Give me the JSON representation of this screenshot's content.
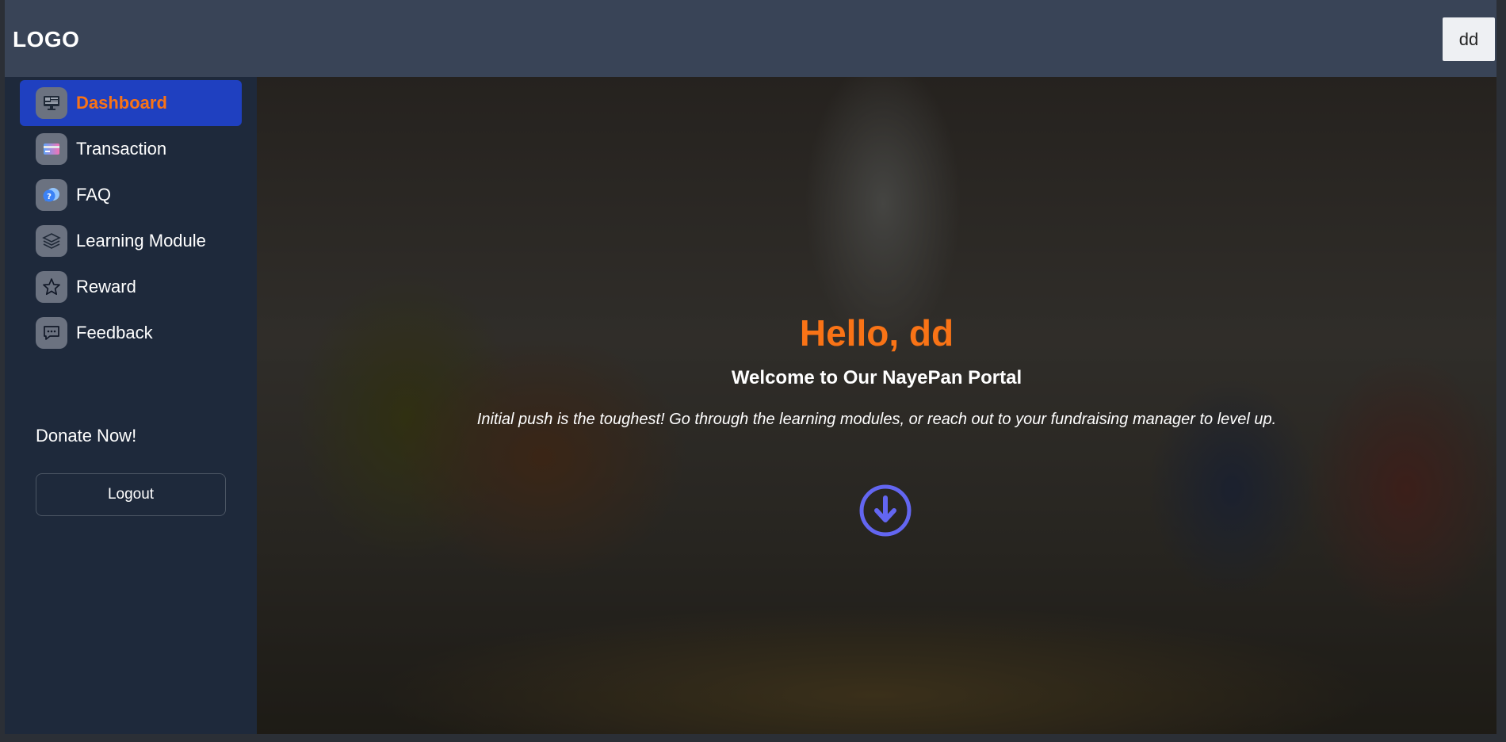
{
  "header": {
    "logo": "LOGO",
    "user_button": "dd"
  },
  "sidebar": {
    "items": [
      {
        "label": "Dashboard",
        "icon": "monitor-icon",
        "active": true
      },
      {
        "label": "Transaction",
        "icon": "credit-card-icon",
        "active": false
      },
      {
        "label": "FAQ",
        "icon": "question-bubble-icon",
        "active": false
      },
      {
        "label": "Learning Module",
        "icon": "layers-icon",
        "active": false
      },
      {
        "label": "Reward",
        "icon": "star-icon",
        "active": false
      },
      {
        "label": "Feedback",
        "icon": "chat-bubble-icon",
        "active": false
      }
    ],
    "donate": "Donate Now!",
    "logout": "Logout"
  },
  "hero": {
    "greeting": "Hello, dd",
    "welcome": "Welcome to Our NayePan Portal",
    "tagline": "Initial push is the toughest! Go through the learning modules, or reach out to your fundraising manager to level up.",
    "scroll_icon": "arrow-down-circle-icon"
  },
  "colors": {
    "accent": "#f97316",
    "active_nav": "#1f40c0",
    "header_bg": "#394457",
    "sidebar_bg": "#1e293b",
    "scroll_icon": "#6366f1"
  }
}
